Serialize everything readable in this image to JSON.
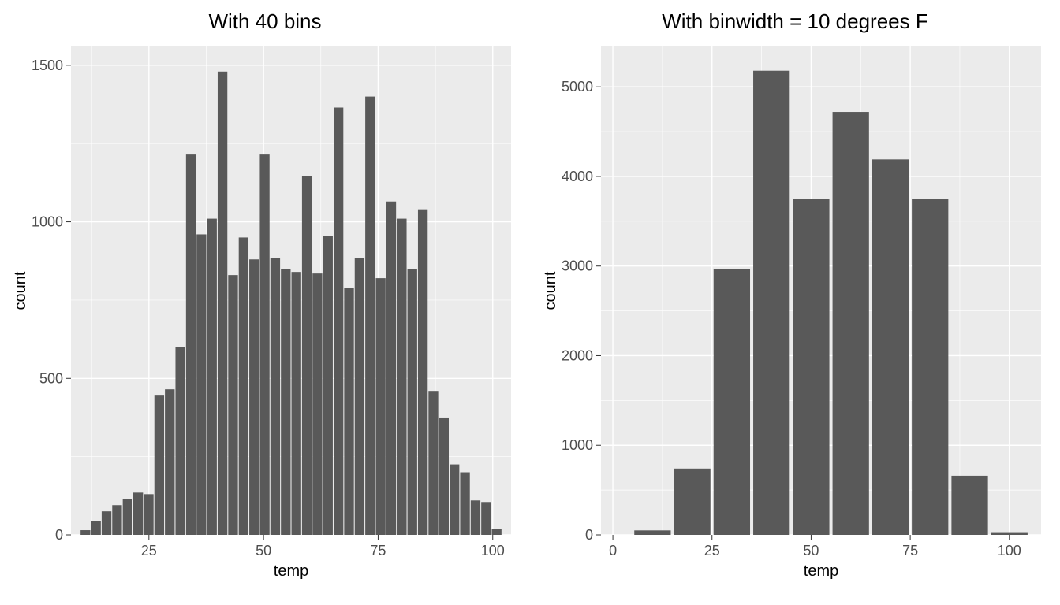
{
  "chart_data": [
    {
      "type": "bar",
      "title": "With 40 bins",
      "xlabel": "temp",
      "ylabel": "count",
      "x_ticks": [
        25,
        50,
        75,
        100
      ],
      "y_ticks": [
        0,
        500,
        1000,
        1500
      ],
      "xlim": [
        8,
        104
      ],
      "ylim": [
        0,
        1560
      ],
      "binwidth": 2.3,
      "categories": [
        11.15,
        13.45,
        15.75,
        18.05,
        20.35,
        22.65,
        24.95,
        27.25,
        29.55,
        31.85,
        34.15,
        36.45,
        38.75,
        41.05,
        43.35,
        45.65,
        47.95,
        50.25,
        52.55,
        54.85,
        57.15,
        59.45,
        61.75,
        64.05,
        66.35,
        68.65,
        70.95,
        73.25,
        75.55,
        77.85,
        80.15,
        82.45,
        84.75,
        87.05,
        89.35,
        91.65,
        93.95,
        96.25,
        98.55,
        100.85
      ],
      "values": [
        15,
        45,
        75,
        95,
        115,
        135,
        130,
        445,
        465,
        600,
        1215,
        960,
        1010,
        1480,
        830,
        950,
        880,
        1215,
        885,
        850,
        840,
        1145,
        835,
        955,
        1365,
        790,
        885,
        1400,
        820,
        1065,
        1010,
        850,
        1040,
        460,
        375,
        225,
        200,
        110,
        105,
        20
      ]
    },
    {
      "type": "bar",
      "title": "With binwidth = 10 degrees F",
      "xlabel": "temp",
      "ylabel": "count",
      "x_ticks": [
        0,
        25,
        50,
        75,
        100
      ],
      "y_ticks": [
        0,
        1000,
        2000,
        3000,
        4000,
        5000
      ],
      "xlim": [
        -3,
        108
      ],
      "ylim": [
        0,
        5450
      ],
      "binwidth": 10,
      "categories": [
        10,
        20,
        30,
        40,
        50,
        60,
        70,
        80,
        90,
        100
      ],
      "values": [
        50,
        740,
        2970,
        5180,
        3750,
        4720,
        4190,
        3750,
        660,
        30
      ]
    }
  ]
}
